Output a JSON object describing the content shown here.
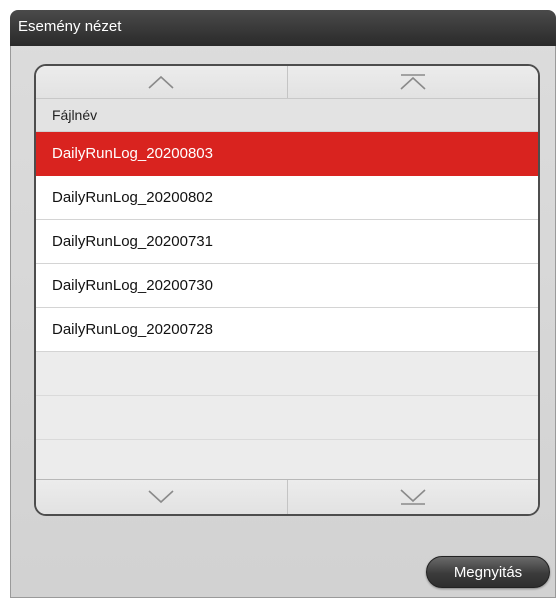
{
  "window": {
    "title": "Esemény nézet"
  },
  "file_list": {
    "column_header": "Fájlnév",
    "selected_index": 0,
    "items": [
      "DailyRunLog_20200803",
      "DailyRunLog_20200802",
      "DailyRunLog_20200731",
      "DailyRunLog_20200730",
      "DailyRunLog_20200728"
    ],
    "empty_rows": 3
  },
  "scroll_buttons": {
    "top": [
      "scroll-up-icon",
      "scroll-to-top-icon"
    ],
    "bottom": [
      "scroll-down-icon",
      "scroll-to-bottom-icon"
    ]
  },
  "actions": {
    "open_label": "Megnyitás"
  },
  "colors": {
    "selection": "#d9231f",
    "title_bar": "#2a2a2a",
    "dialog_background": "#d6d6d6"
  }
}
